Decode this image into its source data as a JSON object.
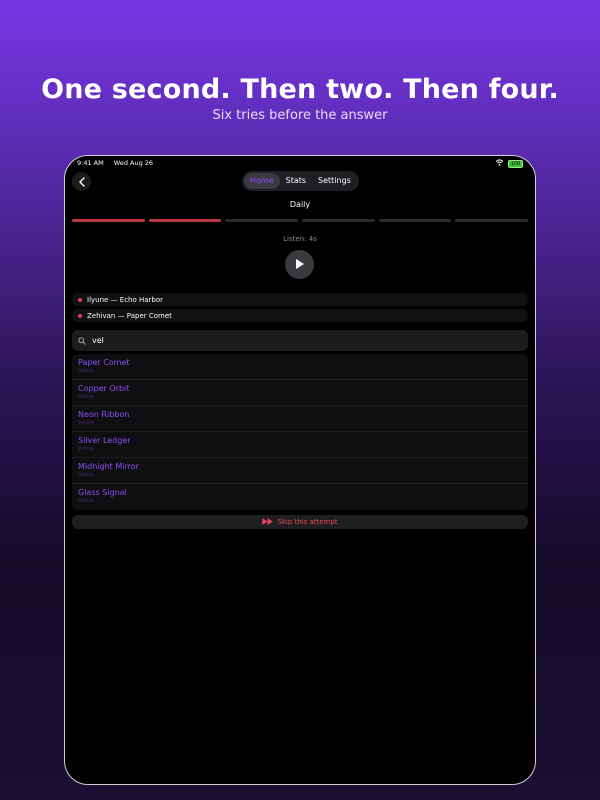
{
  "headline": "One second. Then two. Then four.",
  "subhead": "Six tries before the answer",
  "status_bar": {
    "time": "9:41 AM",
    "date": "Wed Aug 26",
    "battery": "100"
  },
  "nav": {
    "back_icon": "chevron-left-icon",
    "tabs": [
      {
        "label": "Home",
        "active": true
      },
      {
        "label": "Stats",
        "active": false
      },
      {
        "label": "Settings",
        "active": false
      }
    ]
  },
  "mode_label": "Daily",
  "attempts": {
    "total": 6,
    "used": 2
  },
  "listen_label": "Listen: 4s",
  "play_icon": "play-icon",
  "guesses": [
    {
      "text": "Ilyune — Echo Harbor"
    },
    {
      "text": "Zehivan — Paper Comet"
    }
  ],
  "search": {
    "value": "vel",
    "icon": "search-icon"
  },
  "results": [
    {
      "title": "Paper Comet",
      "artist": "Velora"
    },
    {
      "title": "Copper Orbit",
      "artist": "Velora"
    },
    {
      "title": "Neon Ribbon",
      "artist": "Velora"
    },
    {
      "title": "Silver Ledger",
      "artist": "Velora"
    },
    {
      "title": "Midnight Mirror",
      "artist": "Velora"
    },
    {
      "title": "Glass Signal",
      "artist": "Velora"
    }
  ],
  "skip": {
    "label": "Skip this attempt",
    "icon": "fast-forward-icon"
  },
  "colors": {
    "accent": "#8b4dff",
    "attempt_used": "#b83a44",
    "skip": "#e0485a"
  }
}
